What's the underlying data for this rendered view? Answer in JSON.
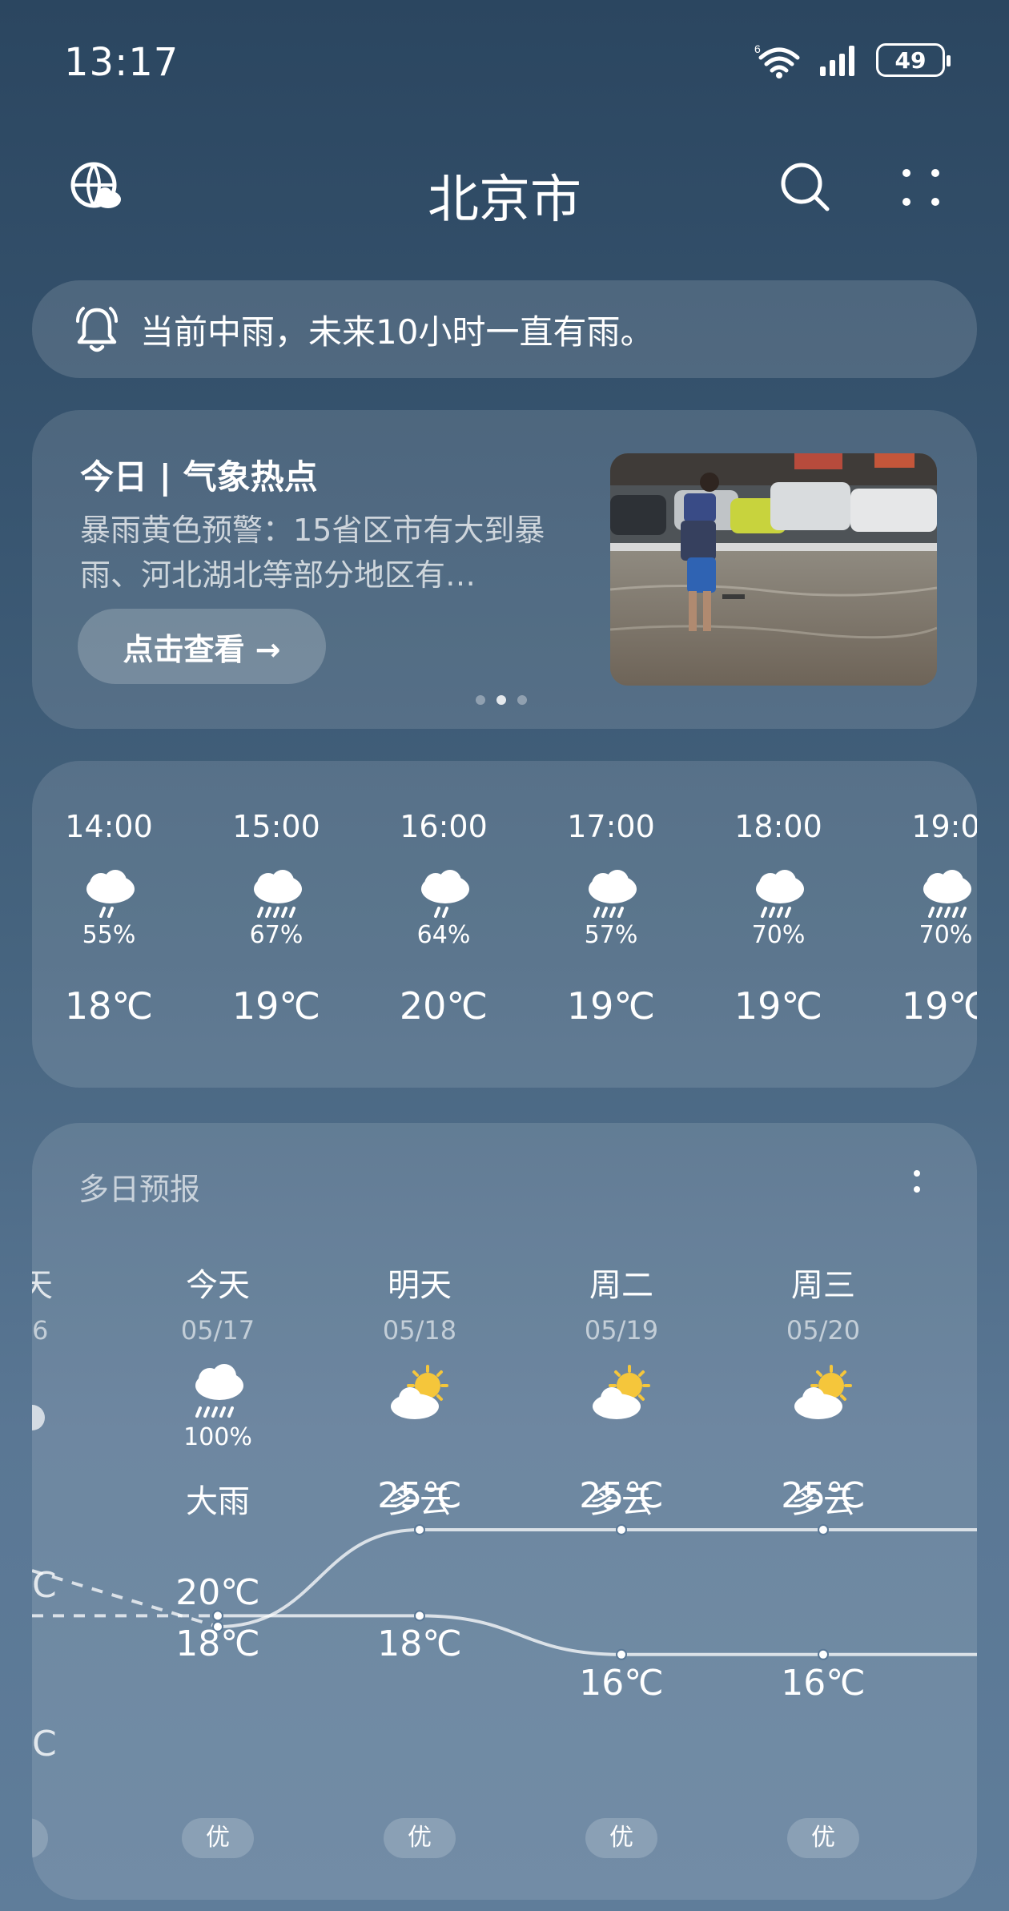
{
  "status": {
    "time": "13:17",
    "battery": "49"
  },
  "header": {
    "city": "北京市"
  },
  "alert": {
    "text": "当前中雨，未来10小时一直有雨。"
  },
  "hot": {
    "title": "今日 | 气象热点",
    "desc": "暴雨黄色预警：15省区市有大到暴雨、河北湖北等部分地区有…",
    "button": "点击查看 →"
  },
  "hourly": [
    {
      "time": "14:00",
      "precip": "55%",
      "temp": "18℃",
      "icon": "rain-cloud-icon"
    },
    {
      "time": "15:00",
      "precip": "67%",
      "temp": "19℃",
      "icon": "rain-cloud-icon"
    },
    {
      "time": "16:00",
      "precip": "64%",
      "temp": "20℃",
      "icon": "rain-cloud-icon"
    },
    {
      "time": "17:00",
      "precip": "57%",
      "temp": "19℃",
      "icon": "rain-cloud-icon"
    },
    {
      "time": "18:00",
      "precip": "70%",
      "temp": "19℃",
      "icon": "rain-cloud-icon"
    },
    {
      "time": "19:0",
      "precip": "70%",
      "temp": "19℃",
      "icon": "rain-cloud-icon"
    }
  ],
  "daily": {
    "title": "多日预报",
    "prev_partial": {
      "name": "天",
      "date": "6",
      "hi": "C",
      "lo": "C"
    },
    "days": [
      {
        "name": "今天",
        "date": "05/17",
        "precip": "100%",
        "cond": "大雨",
        "hi": "20℃",
        "lo": "18℃",
        "hi_val": 20,
        "lo_val": 18,
        "aqi": "优",
        "icon": "heavy-rain-cloud-icon"
      },
      {
        "name": "明天",
        "date": "05/18",
        "precip": "",
        "cond": "多云",
        "hi": "25℃",
        "lo": "18℃",
        "hi_val": 25,
        "lo_val": 18,
        "aqi": "优",
        "icon": "partly-cloudy-icon"
      },
      {
        "name": "周二",
        "date": "05/19",
        "precip": "",
        "cond": "多云",
        "hi": "25℃",
        "lo": "16℃",
        "hi_val": 25,
        "lo_val": 16,
        "aqi": "优",
        "icon": "partly-cloudy-icon"
      },
      {
        "name": "周三",
        "date": "05/20",
        "precip": "",
        "cond": "多云",
        "hi": "25℃",
        "lo": "16℃",
        "hi_val": 25,
        "lo_val": 16,
        "aqi": "优",
        "icon": "partly-cloudy-icon"
      }
    ]
  }
}
